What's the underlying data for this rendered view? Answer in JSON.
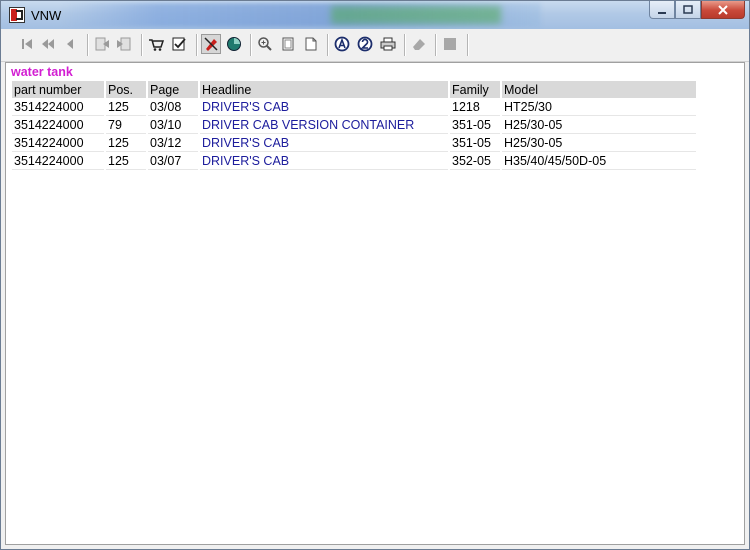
{
  "window": {
    "title": "VNW"
  },
  "toolbar": {
    "buttons": [
      {
        "name": "first-icon"
      },
      {
        "name": "previous-page-icon"
      },
      {
        "name": "previous-icon"
      },
      {
        "name": "back-doc-icon"
      },
      {
        "name": "forward-doc-icon"
      },
      {
        "name": "cart-icon"
      },
      {
        "name": "checklist-icon"
      },
      {
        "name": "marker-icon",
        "pressed": true
      },
      {
        "name": "globe-icon"
      },
      {
        "name": "zoom-icon"
      },
      {
        "name": "page-icon"
      },
      {
        "name": "page-fold-icon"
      },
      {
        "name": "a-circle-icon"
      },
      {
        "name": "two-circle-icon"
      },
      {
        "name": "print-icon"
      },
      {
        "name": "eraser-icon"
      },
      {
        "name": "stop-icon"
      }
    ]
  },
  "results": {
    "heading": "water tank",
    "columns": [
      "part number",
      "Pos.",
      "Page",
      "Headline",
      "Family",
      "Model"
    ],
    "rows": [
      [
        "3514224000",
        "125",
        "03/08",
        "DRIVER'S CAB",
        "1218",
        "HT25/30"
      ],
      [
        "3514224000",
        "79",
        "03/10",
        "DRIVER CAB VERSION CONTAINER",
        "351-05",
        "H25/30-05"
      ],
      [
        "3514224000",
        "125",
        "03/12",
        "DRIVER'S CAB",
        "351-05",
        "H25/30-05"
      ],
      [
        "3514224000",
        "125",
        "03/07",
        "DRIVER'S CAB",
        "352-05",
        "H35/40/45/50D-05"
      ]
    ]
  },
  "colors": {
    "heading": "#d21ed2",
    "link": "#1c1c9c",
    "header_bg": "#d9d9d9"
  }
}
